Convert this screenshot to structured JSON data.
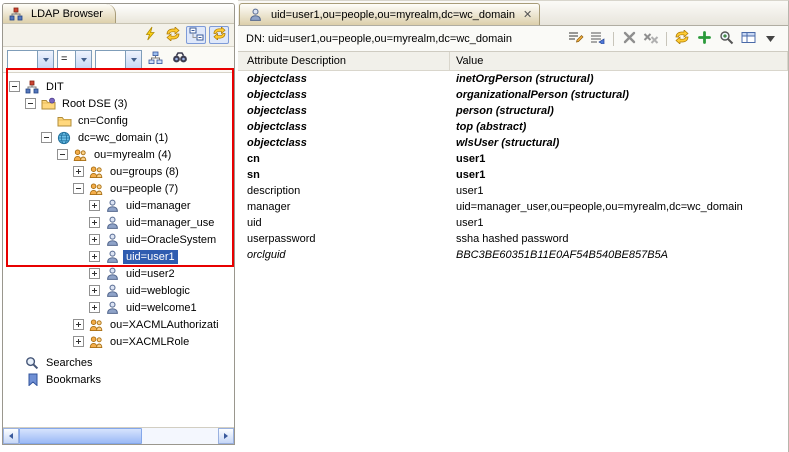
{
  "colors": {
    "selection_bg": "#2f5cb0",
    "selection_text": "#ffffff",
    "tab_gradient_top": "#fefdf8",
    "tab_gradient_bottom": "#ddd0ab",
    "annotation_red": "#e80000",
    "scrollbar_blue": "#9cbaf6",
    "border_gray": "#9a978e"
  },
  "left_panel": {
    "tab_label": "LDAP Browser",
    "tab_icon": "ldap-browser-icon",
    "toolbar_icons": [
      "connect-icon",
      "refresh-icon",
      "collapse-all-icon",
      "link-with-editor-icon"
    ],
    "quick_search": {
      "attribute_value": "",
      "operator_value": "=",
      "value_value": "",
      "button_icons": [
        "subtree-search-icon",
        "search-icon"
      ]
    },
    "tree": [
      {
        "label": "DIT",
        "icon": "dit-icon",
        "expander": "minus"
      },
      {
        "label": "Root DSE (3)",
        "icon": "root-dse-icon",
        "expander": "minus"
      },
      {
        "label": "cn=Config",
        "icon": "folder-icon",
        "expander": "none"
      },
      {
        "label": "dc=wc_domain (1)",
        "icon": "globe-icon",
        "expander": "minus"
      },
      {
        "label": "ou=myrealm (4)",
        "icon": "org-unit-icon",
        "expander": "minus"
      },
      {
        "label": "ou=groups (8)",
        "icon": "org-unit-icon",
        "expander": "plus"
      },
      {
        "label": "ou=people (7)",
        "icon": "org-unit-icon",
        "expander": "minus"
      },
      {
        "label": "uid=manager",
        "icon": "person-icon",
        "expander": "plus"
      },
      {
        "label": "uid=manager_use",
        "icon": "person-icon",
        "expander": "plus"
      },
      {
        "label": "uid=OracleSystem",
        "icon": "person-icon",
        "expander": "plus"
      },
      {
        "label": "uid=user1",
        "icon": "person-icon",
        "expander": "plus",
        "selected": true
      },
      {
        "label": "uid=user2",
        "icon": "person-icon",
        "expander": "plus"
      },
      {
        "label": "uid=weblogic",
        "icon": "person-icon",
        "expander": "plus"
      },
      {
        "label": "uid=welcome1",
        "icon": "person-icon",
        "expander": "plus"
      },
      {
        "label": "ou=XACMLAuthorizati",
        "icon": "org-unit-icon",
        "expander": "plus"
      },
      {
        "label": "ou=XACMLRole",
        "icon": "org-unit-icon",
        "expander": "plus"
      },
      {
        "label": "Searches",
        "icon": "searches-icon",
        "expander": "none"
      },
      {
        "label": "Bookmarks",
        "icon": "bookmarks-icon",
        "expander": "none"
      }
    ]
  },
  "editor": {
    "tab_label": "uid=user1,ou=people,ou=myrealm,dc=wc_domain",
    "tab_icon": "entry-icon",
    "close_glyph": "✕",
    "dn_label": "DN: uid=user1,ou=people,ou=myrealm,dc=wc_domain",
    "toolbar_icons": [
      "value-editor-icon",
      "entry-wizard-icon",
      "delete-icon",
      "delete-all-icon",
      "refresh-icon",
      "add-attribute-icon",
      "zoom-icon",
      "settings-icon",
      "menu-icon"
    ],
    "table": {
      "columns": [
        "Attribute Description",
        "Value"
      ],
      "rows": [
        {
          "attribute": "objectclass",
          "value": "inetOrgPerson (structural)",
          "style": "bold-italic"
        },
        {
          "attribute": "objectclass",
          "value": "organizationalPerson (structural)",
          "style": "bold-italic"
        },
        {
          "attribute": "objectclass",
          "value": "person (structural)",
          "style": "bold-italic"
        },
        {
          "attribute": "objectclass",
          "value": "top (abstract)",
          "style": "bold-italic"
        },
        {
          "attribute": "objectclass",
          "value": "wlsUser (structural)",
          "style": "bold-italic"
        },
        {
          "attribute": "cn",
          "value": "user1",
          "style": "bold"
        },
        {
          "attribute": "sn",
          "value": "user1",
          "style": "bold"
        },
        {
          "attribute": "description",
          "value": "user1",
          "style": "normal"
        },
        {
          "attribute": "manager",
          "value": "uid=manager_user,ou=people,ou=myrealm,dc=wc_domain",
          "style": "normal"
        },
        {
          "attribute": "uid",
          "value": "user1",
          "style": "normal"
        },
        {
          "attribute": "userpassword",
          "value": "ssha hashed password",
          "style": "normal"
        },
        {
          "attribute": "orclguid",
          "value": "BBC3BE60351B11E0AF54B540BE857B5A",
          "style": "italic"
        }
      ]
    }
  }
}
